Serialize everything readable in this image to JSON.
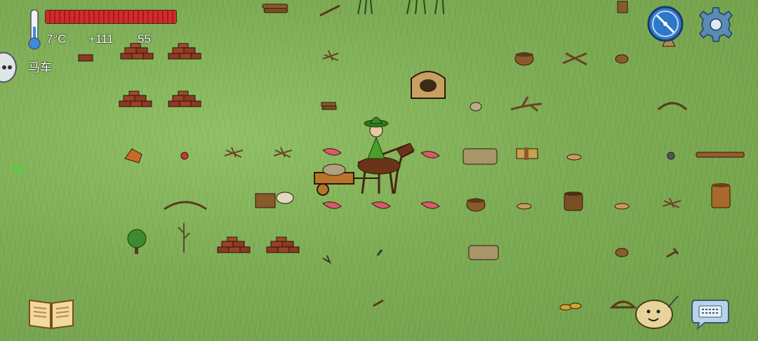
{
  "hud": {
    "temperature": "7°C",
    "score": "+111",
    "age": "55",
    "location": "马车",
    "fps": "60",
    "health_fraction": 1.0
  },
  "icons": {
    "thermometer": "thermometer-icon",
    "compass": "compass-icon",
    "settings": "gear-icon",
    "chat": "chat-bubble-icon",
    "book": "recipe-book-icon",
    "emote": "potato-emote-icon",
    "keyboard": "keyboard-icon"
  },
  "colors": {
    "health_fill": "#d42a2a",
    "fps_text": "#2ee62e",
    "grass": "#7cab53",
    "compass_blue": "#2f78c8"
  }
}
